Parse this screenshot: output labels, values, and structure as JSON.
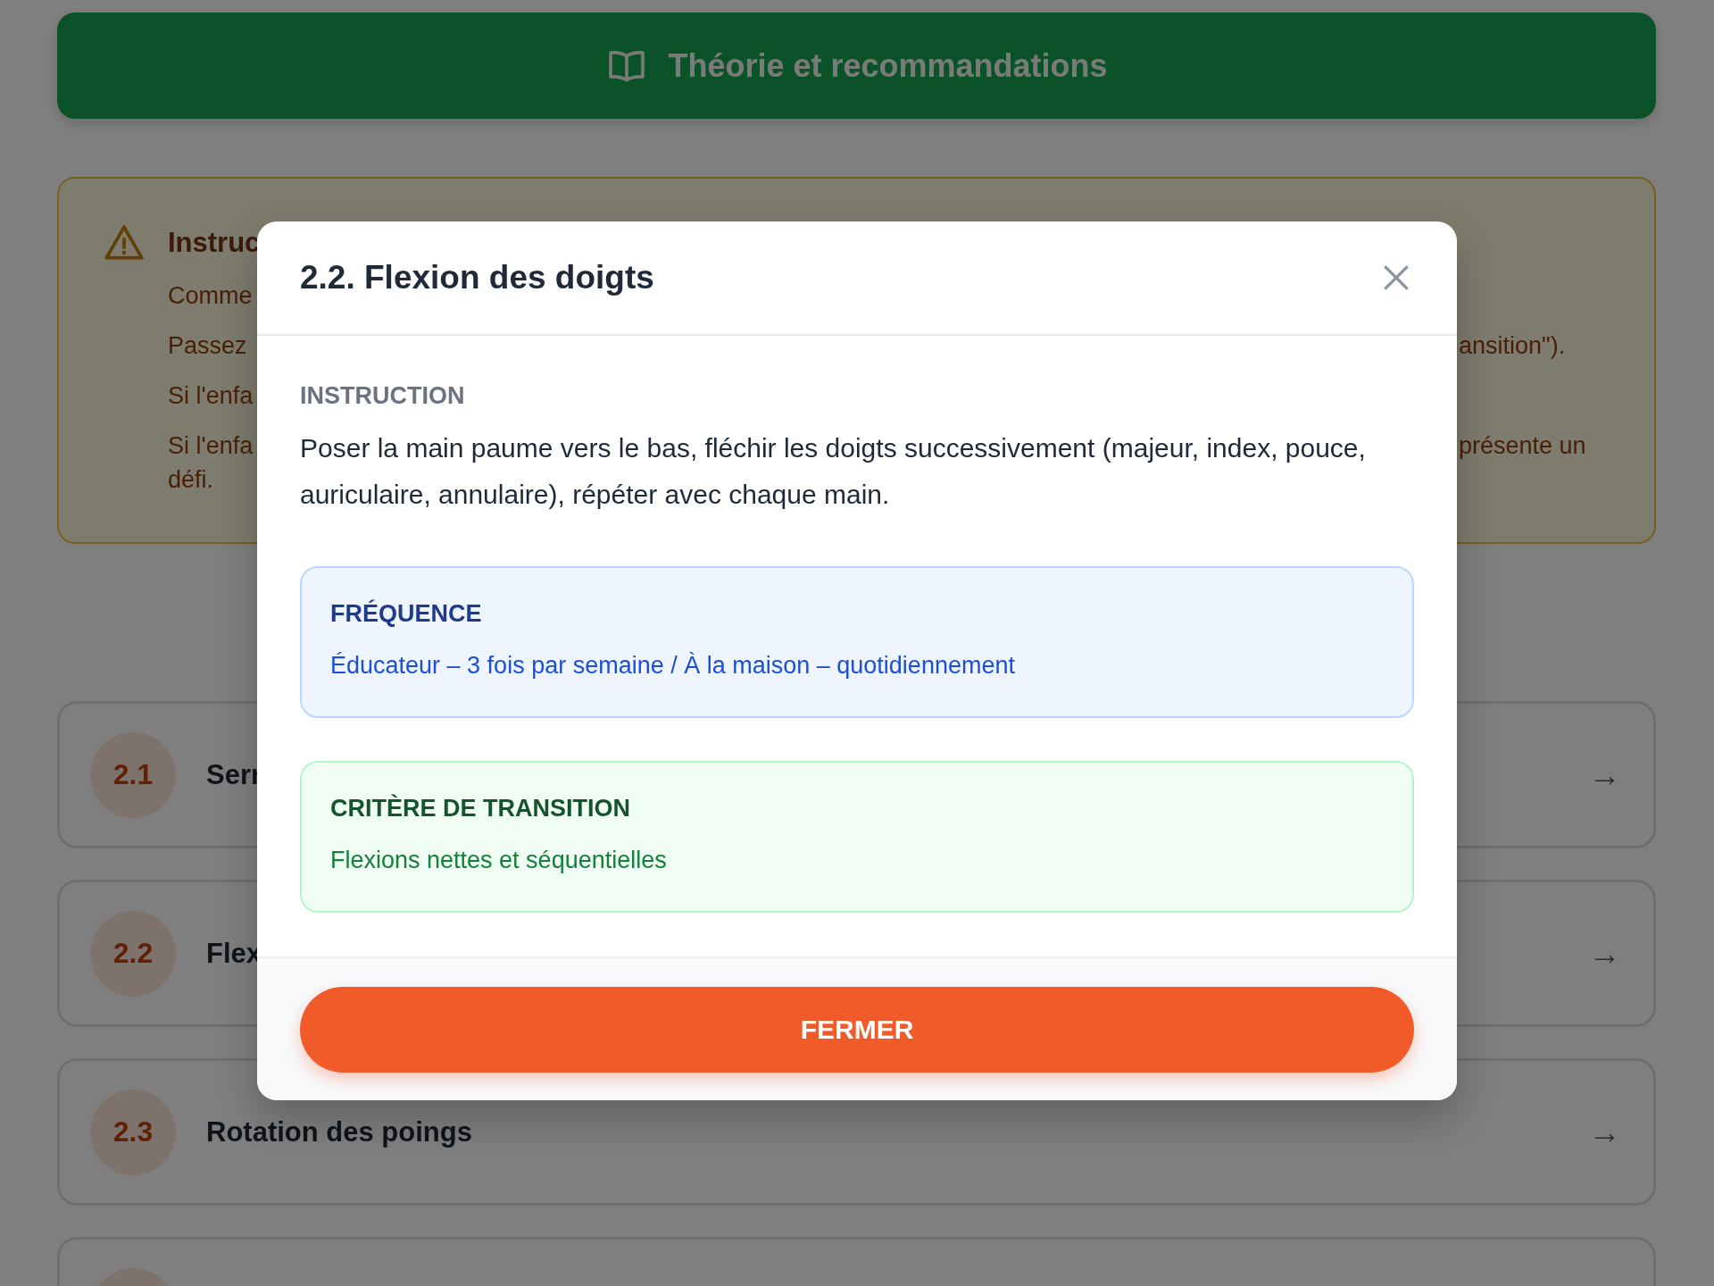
{
  "page": {
    "theory_button": {
      "label": "Théorie et recommandations"
    },
    "instructions_panel": {
      "title": "Instruc",
      "lines": [
        {
          "left": "Comme"
        },
        {
          "left": "Passez",
          "right": "ansition\")."
        },
        {
          "left": "Si l'enfa"
        },
        {
          "left": "Si l'enfa",
          "right": "présente un",
          "wrap": "défi."
        }
      ]
    },
    "exercises": [
      {
        "kind": "exercise",
        "number": "2.1",
        "title": "Serr",
        "arrow": "→"
      },
      {
        "kind": "exercise",
        "number": "2.2",
        "title": "Flex",
        "arrow": "→"
      },
      {
        "kind": "exercise",
        "number": "2.3",
        "title": "Rotation des poings",
        "arrow": "→"
      },
      {
        "kind": "cut_off"
      }
    ]
  },
  "modal": {
    "title": "2.2. Flexion des doigts",
    "instruction": {
      "label": "INSTRUCTION",
      "text": "Poser la main paume vers le bas, fléchir les doigts successivement (majeur, index, pouce, auriculaire, annulaire), répéter avec chaque main."
    },
    "callouts": [
      {
        "kind": "frequency",
        "label": "FRÉQUENCE",
        "text": "Éducateur – 3 fois par semaine / À la maison – quotidiennement"
      },
      {
        "kind": "transition",
        "label": "CRITÈRE DE TRANSITION",
        "text": "Flexions nettes et séquentielles"
      }
    ],
    "button": "FERMER"
  }
}
